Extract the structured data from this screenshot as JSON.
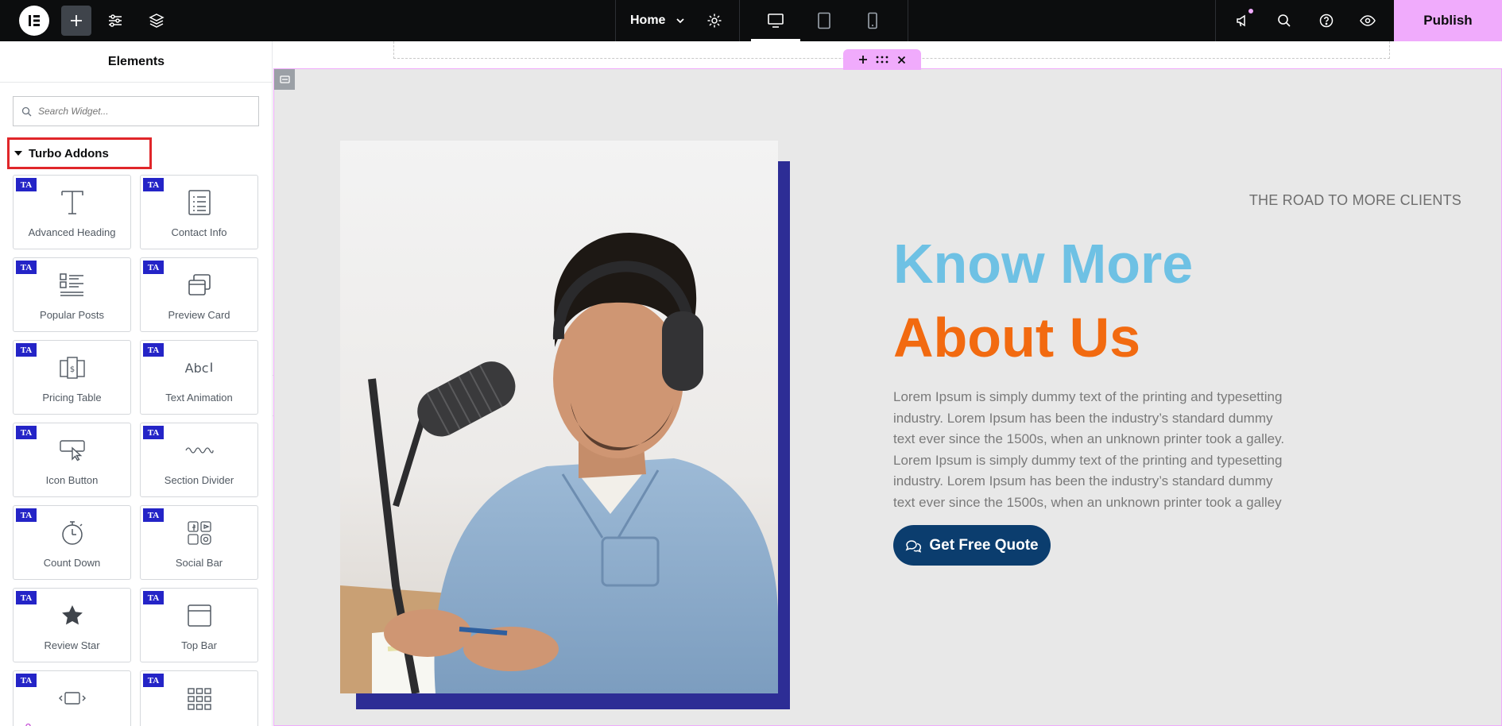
{
  "topbar": {
    "page_name": "Home",
    "publish_label": "Publish",
    "icons": [
      "elementor-logo-icon",
      "plus-icon",
      "sliders-icon",
      "layers-icon",
      "chevron-down-icon",
      "gear-icon",
      "desktop-icon",
      "tablet-icon",
      "mobile-icon",
      "megaphone-icon",
      "search-icon",
      "help-icon",
      "eye-icon"
    ],
    "accent_color": "#f0abfc"
  },
  "panel": {
    "title": "Elements",
    "search_placeholder": "Search Widget...",
    "category": "Turbo Addons",
    "badge": "TA",
    "widgets": [
      {
        "label": "Advanced Heading",
        "icon": "heading-icon"
      },
      {
        "label": "Contact Info",
        "icon": "contact-list-icon"
      },
      {
        "label": "Popular Posts",
        "icon": "posts-list-icon"
      },
      {
        "label": "Preview Card",
        "icon": "card-stack-icon"
      },
      {
        "label": "Pricing Table",
        "icon": "pricing-table-icon"
      },
      {
        "label": "Text Animation",
        "icon": "text-cursor-icon"
      },
      {
        "label": "Icon Button",
        "icon": "pointer-button-icon"
      },
      {
        "label": "Section Divider",
        "icon": "wave-divider-icon"
      },
      {
        "label": "Count Down",
        "icon": "stopwatch-icon"
      },
      {
        "label": "Social Bar",
        "icon": "social-icons-icon"
      },
      {
        "label": "Review Star",
        "icon": "star-icon"
      },
      {
        "label": "Top Bar",
        "icon": "window-bar-icon"
      },
      {
        "label": "",
        "icon": "slider-arrows-icon"
      },
      {
        "label": "",
        "icon": "grid-icon"
      }
    ],
    "text_animation_glyph": "Abc"
  },
  "canvas": {
    "kicker": "THE ROAD TO MORE CLIENTS",
    "heading_line1": "Know More",
    "heading_line2": "About Us",
    "heading_color_1": "#6ec1e4",
    "heading_color_2": "#f26a10",
    "paragraph": [
      "Lorem Ipsum is simply dummy text of the printing and typesetting",
      "industry. Lorem Ipsum has been the industry’s standard dummy",
      "text ever since the 1500s, when an unknown printer took a galley.",
      "Lorem Ipsum is simply dummy text of the printing and typesetting",
      "industry. Lorem Ipsum has been the industry’s standard dummy",
      "text ever since the 1500s, when an unknown printer took a galley"
    ],
    "button_label": "Get Free Quote",
    "button_color": "#0b3d6e",
    "frame_color": "#2d2d95",
    "section_handle_icons": [
      "plus-icon",
      "drag-handle-icon",
      "close-icon"
    ]
  }
}
